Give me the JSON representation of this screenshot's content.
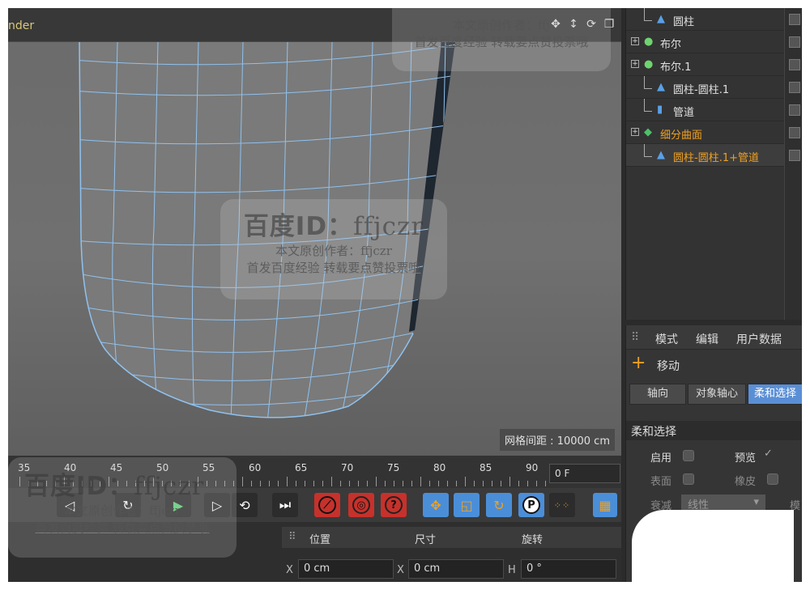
{
  "viewport": {
    "title": "nder",
    "grid_spacing": "网格间距 : 10000 cm",
    "tool_icons": [
      "move-arrows-icon",
      "move-vertical-icon",
      "rotate-icon",
      "maximize-view-icon"
    ]
  },
  "watermark": {
    "big_label": "百度ID：",
    "big_id": "ffjczr",
    "line2": "本文原创作者：ffjczr",
    "line3": "首发百度经验  转载要点赞投票哦",
    "top_partial": "本文原创作者：ffj"
  },
  "timeline": {
    "ticks": [
      "35",
      "40",
      "45",
      "50",
      "55",
      "60",
      "65",
      "70",
      "75",
      "80",
      "85",
      "90"
    ],
    "frame_value": "0 F"
  },
  "transport": {
    "buttons": [
      {
        "name": "play-forward-icon",
        "glyph": "▶"
      },
      {
        "name": "next-key-icon",
        "glyph": "▷"
      },
      {
        "name": "loop-icon",
        "glyph": "↻"
      },
      {
        "name": "go-to-end-icon",
        "glyph": "⏭"
      }
    ],
    "record_buttons": [
      "record-key-icon",
      "autokey-icon",
      "keyframe-selection-icon"
    ],
    "mode_buttons": [
      "move-key-icon",
      "scale-key-icon",
      "rotate-key-icon",
      "param-key-icon",
      "point-level-icon"
    ]
  },
  "coords": {
    "headers": {
      "position": "位置",
      "size": "尺寸",
      "rotation": "旋转"
    },
    "x_label": "X",
    "x_value": "0 cm",
    "size_label": "X",
    "size_value": "0 cm",
    "h_label": "H",
    "h_value": "0 °"
  },
  "objects": [
    {
      "name": "圆柱",
      "icon": "cylinder-icon",
      "depth": 1,
      "expander": false,
      "highlight": false
    },
    {
      "name": "布尔",
      "icon": "boole-icon",
      "depth": 0,
      "expander": true,
      "highlight": false
    },
    {
      "name": "布尔.1",
      "icon": "boole-icon",
      "depth": 0,
      "expander": true,
      "highlight": false
    },
    {
      "name": "圆柱-圆柱.1",
      "icon": "polygon-object-icon",
      "depth": 1,
      "expander": false,
      "highlight": false
    },
    {
      "name": "管道",
      "icon": "tube-icon",
      "depth": 1,
      "expander": false,
      "highlight": false
    },
    {
      "name": "细分曲面",
      "icon": "subdivision-surface-icon",
      "depth": 0,
      "expander": true,
      "highlight": true
    },
    {
      "name": "圆柱-圆柱.1+管道",
      "icon": "polygon-object-icon",
      "depth": 1,
      "expander": false,
      "highlight": true
    }
  ],
  "attributes": {
    "menu": [
      "模式",
      "编辑",
      "用户数据"
    ],
    "tool_title": "移动",
    "tabs": [
      "轴向",
      "对象轴心",
      "柔和选择"
    ],
    "active_tab": "柔和选择",
    "section": "柔和选择",
    "enable_label": "启用",
    "preview_label": "预览",
    "preview_check": "✓",
    "surface_label": "表面",
    "rubber_label": "橡皮",
    "falloff_label": "衰减",
    "falloff_value": "线性",
    "mode_partial": "模"
  },
  "colors": {
    "mesh_wire": "#8fc2f0",
    "accent_blue": "#5a8fd6",
    "record_red": "#c7312b",
    "highlight_orange": "#f0a020"
  }
}
